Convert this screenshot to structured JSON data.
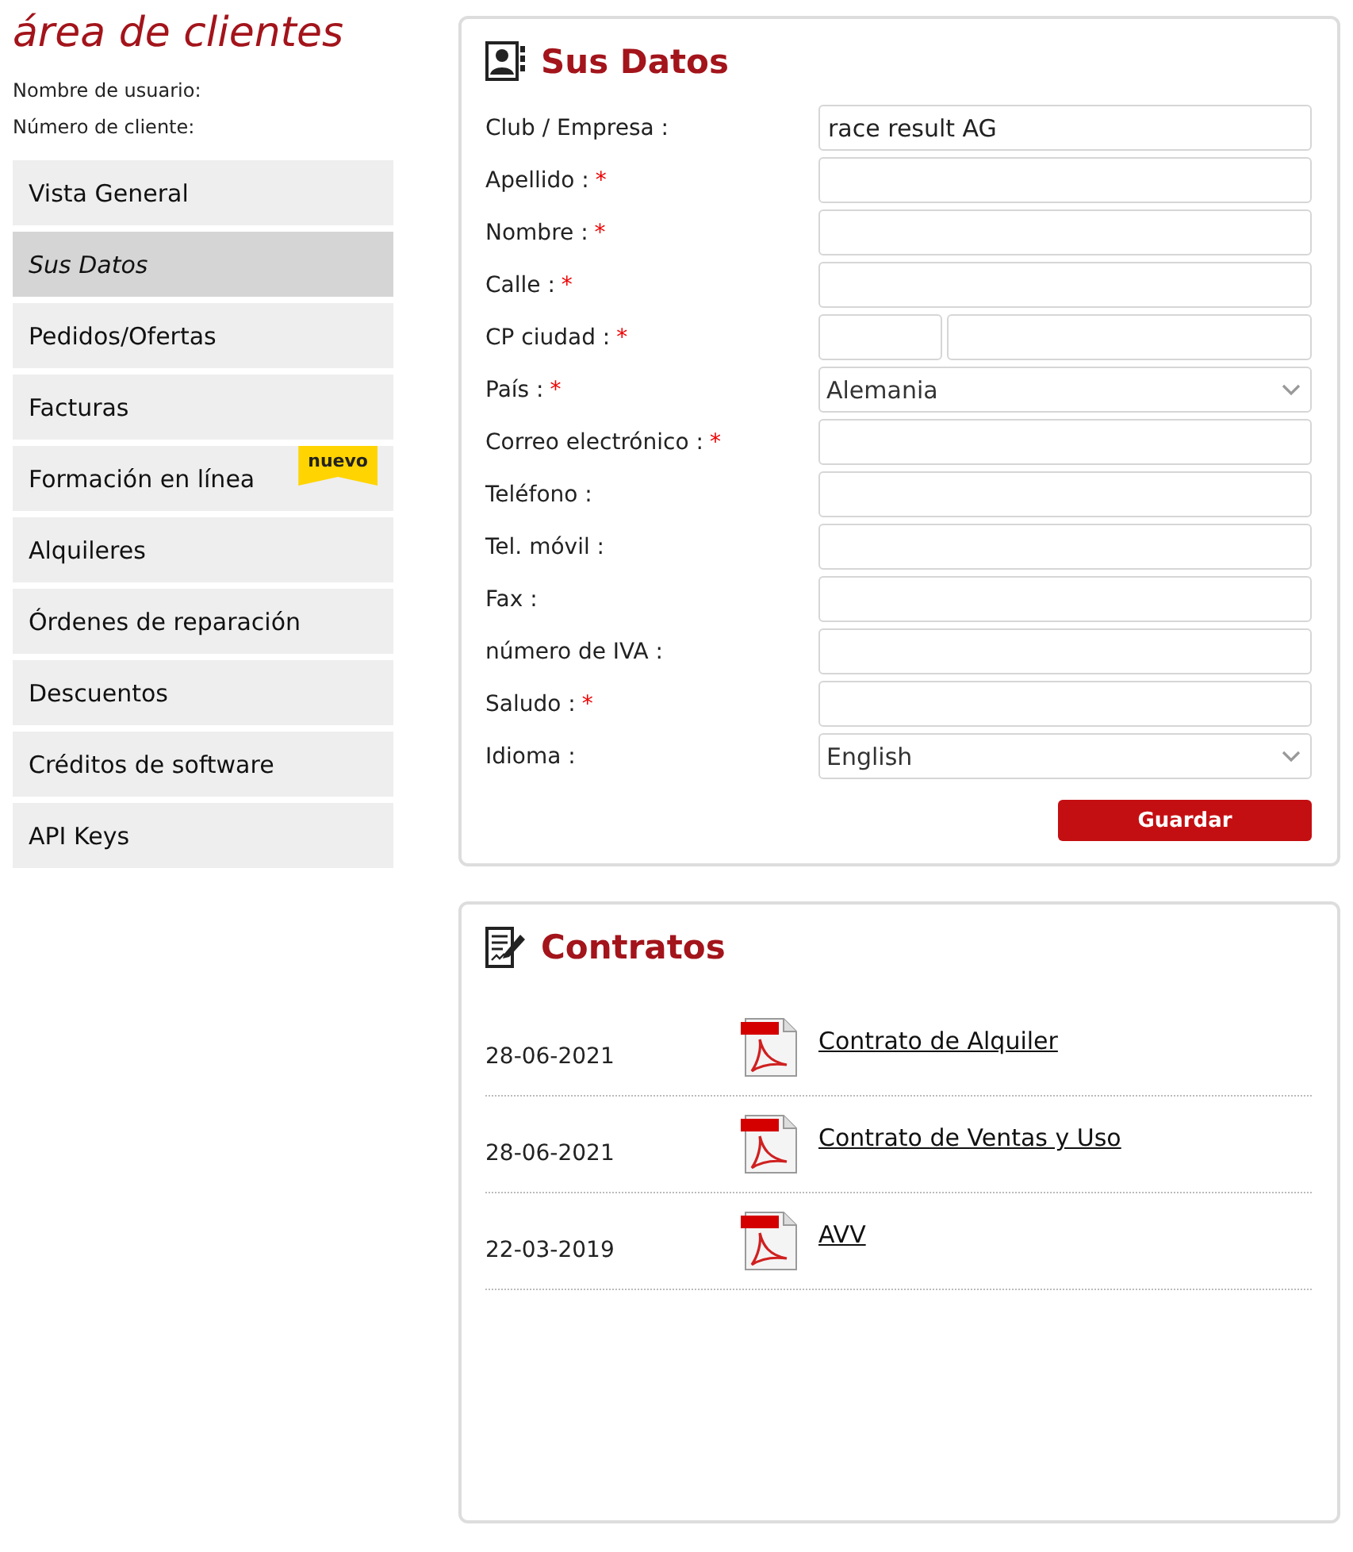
{
  "sidebar": {
    "title": "área de clientes",
    "info": [
      "Nombre de usuario:",
      "Número de cliente:"
    ],
    "items": [
      {
        "label": "Vista General",
        "selected": false
      },
      {
        "label": "Sus Datos",
        "selected": true
      },
      {
        "label": "Pedidos/Ofertas",
        "selected": false
      },
      {
        "label": "Facturas",
        "selected": false
      },
      {
        "label": "Formación en línea",
        "selected": false,
        "badge": "nuevo"
      },
      {
        "label": "Alquileres",
        "selected": false
      },
      {
        "label": "Órdenes de reparación",
        "selected": false
      },
      {
        "label": "Descuentos",
        "selected": false
      },
      {
        "label": "Créditos de software",
        "selected": false
      },
      {
        "label": "API Keys",
        "selected": false
      }
    ]
  },
  "profile": {
    "title": "Sus Datos",
    "fields": [
      {
        "label": "Club / Empresa :",
        "required": false,
        "kind": "text",
        "value": "race result AG"
      },
      {
        "label": "Apellido :",
        "required": true,
        "kind": "text"
      },
      {
        "label": "Nombre :",
        "required": true,
        "kind": "text"
      },
      {
        "label": "Calle :",
        "required": true,
        "kind": "text"
      },
      {
        "label": "CP ciudad :",
        "required": true,
        "kind": "split"
      },
      {
        "label": "País :",
        "required": true,
        "kind": "select",
        "value": "Alemania"
      },
      {
        "label": "Correo electrónico :",
        "required": true,
        "kind": "text"
      },
      {
        "label": "Teléfono :",
        "required": false,
        "kind": "text"
      },
      {
        "label": "Tel. móvil :",
        "required": false,
        "kind": "text"
      },
      {
        "label": "Fax :",
        "required": false,
        "kind": "text"
      },
      {
        "label": "número de IVA :",
        "required": false,
        "kind": "text"
      },
      {
        "label": "Saludo :",
        "required": true,
        "kind": "text"
      },
      {
        "label": "Idioma :",
        "required": false,
        "kind": "select",
        "value": "English"
      }
    ],
    "required_mark": "*",
    "save_button": "Guardar"
  },
  "contracts": {
    "title": "Contratos",
    "rows": [
      {
        "date": "28-06-2021",
        "link": "Contrato de Alquiler"
      },
      {
        "date": "28-06-2021",
        "link": "Contrato de Ventas y Uso"
      },
      {
        "date": "22-03-2019",
        "link": "AVV"
      }
    ]
  }
}
